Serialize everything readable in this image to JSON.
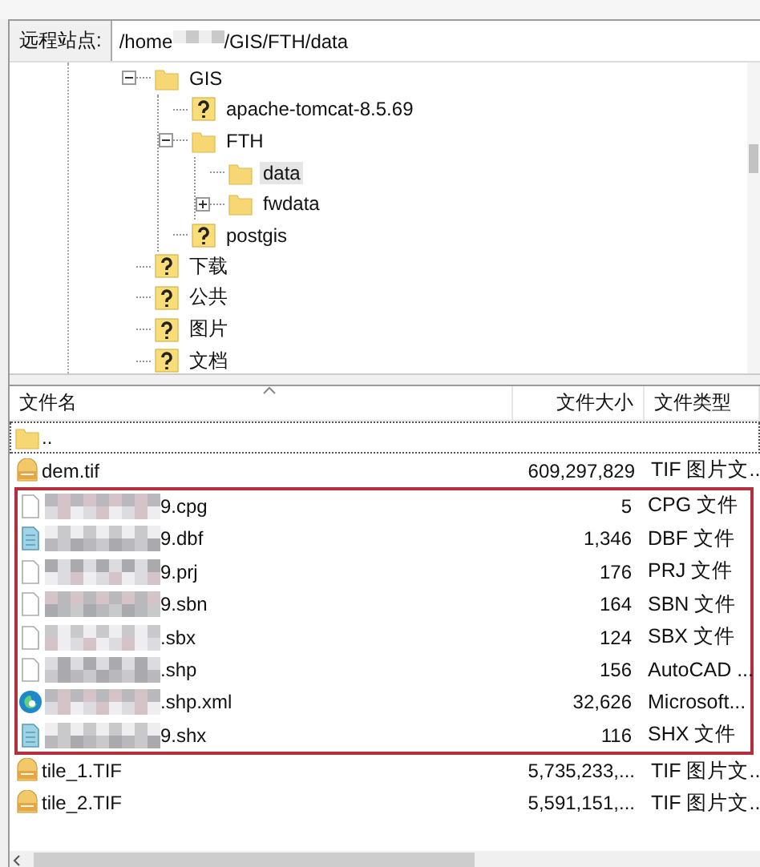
{
  "address": {
    "label": "远程站点:",
    "path_start": "/home",
    "path_end": "/GIS/FTH/data",
    "redacted": true
  },
  "tree": [
    {
      "label": "GIS",
      "kind": "folder",
      "expanded": true,
      "selected": false,
      "children": [
        {
          "label": "apache-tomcat-8.5.69",
          "kind": "unknown",
          "selected": false
        },
        {
          "label": "FTH",
          "kind": "folder",
          "expanded": true,
          "selected": false,
          "children": [
            {
              "label": "data",
              "kind": "folder",
              "selected": true
            },
            {
              "label": "fwdata",
              "kind": "folder",
              "expanded": false,
              "selected": false
            }
          ]
        },
        {
          "label": "postgis",
          "kind": "unknown",
          "selected": false
        }
      ]
    },
    {
      "label": "下载",
      "kind": "unknown",
      "selected": false
    },
    {
      "label": "公共",
      "kind": "unknown",
      "selected": false
    },
    {
      "label": "图片",
      "kind": "unknown",
      "selected": false
    },
    {
      "label": "文档",
      "kind": "unknown",
      "selected": false
    }
  ],
  "file_list": {
    "columns": [
      "文件名",
      "文件大小",
      "文件类型"
    ],
    "groups": [
      {
        "highlighted": false,
        "rows": [
          {
            "name": "..",
            "kind": "folder",
            "redacted": false,
            "focused": true
          },
          {
            "name": "dem.tif",
            "size": "609,297,829",
            "type": "TIF 图片文...",
            "kind": "tif",
            "redacted": false,
            "focused": false
          }
        ]
      },
      {
        "highlighted": true,
        "rows": [
          {
            "name": "9.cpg",
            "size": "5",
            "type": "CPG 文件",
            "kind": "blank",
            "redacted": true,
            "focused": false
          },
          {
            "name": "9.dbf",
            "size": "1,346",
            "type": "DBF 文件",
            "kind": "data",
            "redacted": true,
            "focused": false
          },
          {
            "name": "9.prj",
            "size": "176",
            "type": "PRJ 文件",
            "kind": "blank",
            "redacted": true,
            "focused": false
          },
          {
            "name": "9.sbn",
            "size": "164",
            "type": "SBN 文件",
            "kind": "blank",
            "redacted": true,
            "focused": false
          },
          {
            "name": ".sbx",
            "size": "124",
            "type": "SBX 文件",
            "kind": "blank",
            "redacted": true,
            "focused": false
          },
          {
            "name": ".shp",
            "size": "156",
            "type": "AutoCAD ...",
            "kind": "blank",
            "redacted": true,
            "focused": false
          },
          {
            "name": ".shp.xml",
            "size": "32,626",
            "type": "Microsoft...",
            "kind": "browser",
            "redacted": true,
            "focused": false
          },
          {
            "name": "9.shx",
            "size": "116",
            "type": "SHX 文件",
            "kind": "data",
            "redacted": true,
            "focused": false
          }
        ]
      },
      {
        "highlighted": false,
        "rows": [
          {
            "name": "tile_1.TIF",
            "size": "5,735,233,...",
            "type": "TIF 图片文...",
            "kind": "tif",
            "redacted": false,
            "focused": false
          },
          {
            "name": "tile_2.TIF",
            "size": "5,591,151,...",
            "type": "TIF 图片文...",
            "kind": "tif",
            "redacted": false,
            "focused": false
          }
        ]
      }
    ]
  }
}
